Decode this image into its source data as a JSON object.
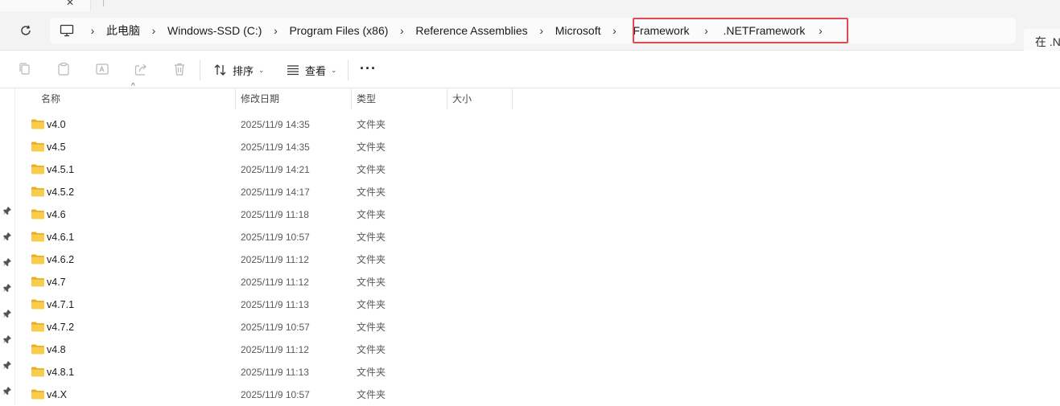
{
  "address": {
    "crumbs": [
      "此电脑",
      "Windows-SSD (C:)",
      "Program Files (x86)",
      "Reference Assemblies",
      "Microsoft",
      "Framework",
      ".NETFramework"
    ],
    "search_prefix": "在 .N"
  },
  "toolbar": {
    "sort_label": "排序",
    "view_label": "查看"
  },
  "columns": {
    "name": "名称",
    "date": "修改日期",
    "type": "类型",
    "size": "大小"
  },
  "rows": [
    {
      "name": "v4.0",
      "date": "2025/11/9 14:35",
      "type": "文件夹"
    },
    {
      "name": "v4.5",
      "date": "2025/11/9 14:35",
      "type": "文件夹"
    },
    {
      "name": "v4.5.1",
      "date": "2025/11/9 14:21",
      "type": "文件夹"
    },
    {
      "name": "v4.5.2",
      "date": "2025/11/9 14:17",
      "type": "文件夹"
    },
    {
      "name": "v4.6",
      "date": "2025/11/9 11:18",
      "type": "文件夹"
    },
    {
      "name": "v4.6.1",
      "date": "2025/11/9 10:57",
      "type": "文件夹"
    },
    {
      "name": "v4.6.2",
      "date": "2025/11/9 11:12",
      "type": "文件夹"
    },
    {
      "name": "v4.7",
      "date": "2025/11/9 11:12",
      "type": "文件夹"
    },
    {
      "name": "v4.7.1",
      "date": "2025/11/9 11:13",
      "type": "文件夹"
    },
    {
      "name": "v4.7.2",
      "date": "2025/11/9 10:57",
      "type": "文件夹"
    },
    {
      "name": "v4.8",
      "date": "2025/11/9 11:12",
      "type": "文件夹"
    },
    {
      "name": "v4.8.1",
      "date": "2025/11/9 11:13",
      "type": "文件夹"
    },
    {
      "name": "v4.X",
      "date": "2025/11/9 10:57",
      "type": "文件夹"
    }
  ],
  "colors": {
    "highlight": "#e5484d",
    "folder": "#f7c948"
  }
}
